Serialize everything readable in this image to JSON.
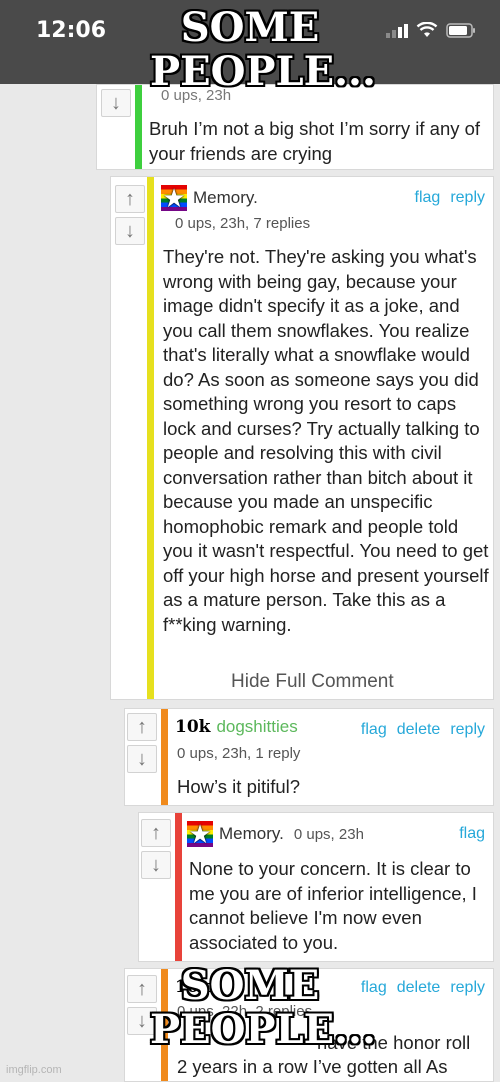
{
  "status_bar": {
    "time": "12:06"
  },
  "meme": {
    "top_text": "SOME PEOPLE...",
    "bottom_text": "SOME PEOPLE..."
  },
  "comments": [
    {
      "meta_partial": "0 ups, 23h",
      "body": "Bruh I’m not a big shot I’m sorry if any of your friends are crying",
      "bar_color": "#3ecf3e"
    },
    {
      "username": "Memory.",
      "meta": "0 ups, 23h, 7 replies",
      "actions": [
        "flag",
        "reply"
      ],
      "body": "They're not. They're asking you what's wrong with being gay, because your image didn't specify it as a joke, and you call them snowflakes. You realize that's literally what a snowflake would do? As soon as someone says you did something wrong you resort to caps lock and curses? Try actually talking to people and resolving this with civil conversation rather than bitch about it because you made an unspecific homophobic remark and people told you it wasn't respectful. You need to get off your high horse and present yourself as a mature person. Take this as a f**king warning.",
      "hide_label": "Hide Full Comment",
      "bar_color": "#e6e01e"
    },
    {
      "badge": "10k",
      "username": "dogshitties",
      "meta": "0 ups, 23h, 1 reply",
      "actions": [
        "flag",
        "delete",
        "reply"
      ],
      "body": "How’s it pitiful?",
      "bar_color": "#f08a1c"
    },
    {
      "username": "Memory.",
      "meta": "0 ups, 23h",
      "actions": [
        "flag"
      ],
      "body": "None to your concern. It is clear to me you are of inferior intelligence, I cannot believe I'm now even associated to you.",
      "bar_color": "#e8433a"
    },
    {
      "badge": "10k",
      "meta": "0 ups, 22h, 2 replies",
      "actions": [
        "flag",
        "delete",
        "reply"
      ],
      "body_line1": "have the honor roll",
      "body_line2": "2 years in a row I’ve gotten all As",
      "bar_color": "#f08a1c"
    }
  ],
  "watermark": "imgflip.com"
}
